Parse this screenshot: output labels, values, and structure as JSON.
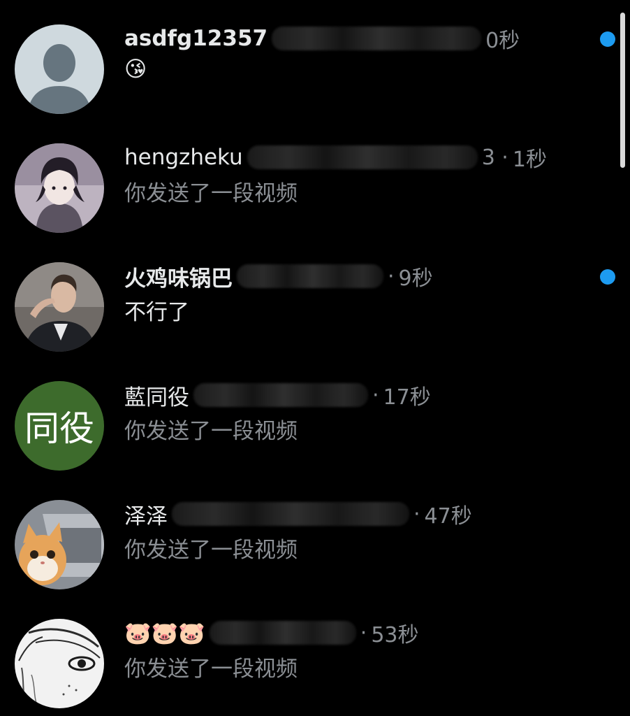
{
  "conversations": [
    {
      "name": "asdfg12357",
      "handle": "@",
      "time_sep": "",
      "time": "0秒",
      "preview": "😘",
      "unread": true,
      "avatar": "default-person-icon"
    },
    {
      "name": "hengzheku",
      "handle": "",
      "time_sep": "3 ·",
      "time": "1秒",
      "preview": "你发送了一段视频",
      "unread": false,
      "avatar": "anime-boy-avatar"
    },
    {
      "name": "火鸡味锅巴",
      "handle": "",
      "time_sep": "·",
      "time": "9秒",
      "preview": "不行了",
      "unread": true,
      "avatar": "man-smoking-avatar"
    },
    {
      "name": "藍同役",
      "handle": "",
      "time_sep": "·",
      "time": "17秒",
      "preview": "你发送了一段视频",
      "unread": false,
      "avatar": "text-avatar",
      "avatar_text": "同役",
      "avatar_color": "#3d6b2c"
    },
    {
      "name": "泽泽",
      "handle": "",
      "time_sep": "·",
      "time": "47秒",
      "preview": "你发送了一段视频",
      "unread": false,
      "avatar": "cat-laptop-avatar"
    },
    {
      "name": "🐷🐷🐷",
      "handle": "",
      "time_sep": "·",
      "time": "53秒",
      "preview": "你发送了一段视频",
      "unread": false,
      "avatar": "manga-sketch-avatar"
    }
  ],
  "colors": {
    "background": "#000000",
    "text_primary": "#e7e9ea",
    "text_secondary": "#8b8f94",
    "unread_dot": "#1d9bf0"
  }
}
